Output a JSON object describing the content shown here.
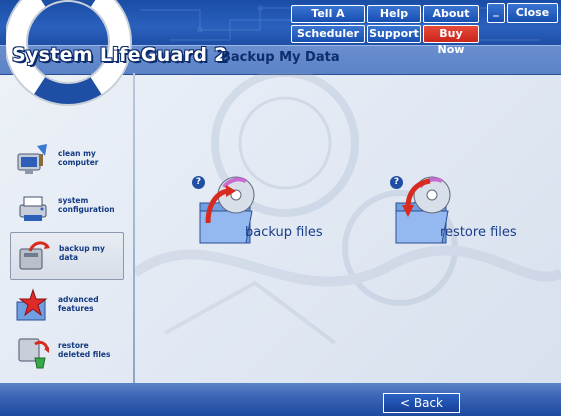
{
  "app": {
    "logo_text": "System LifeGuard 2",
    "page_title": "Backup My Data"
  },
  "header": {
    "tell_friend": "Tell A Friend",
    "help": "Help",
    "about": "About",
    "minimize": "_",
    "close": "Close",
    "scheduler": "Scheduler",
    "support": "Support",
    "buy_now": "Buy Now"
  },
  "sidebar": {
    "items": [
      {
        "label": "clean my\ncomputer",
        "icon": "computer-cleanup-icon"
      },
      {
        "label": "system\nconfiguration",
        "icon": "printer-config-icon"
      },
      {
        "label": "backup my\ndata",
        "icon": "backup-drive-icon",
        "active": true
      },
      {
        "label": "advanced\nfeatures",
        "icon": "star-folder-icon"
      },
      {
        "label": "restore\ndeleted files",
        "icon": "recycle-restore-icon"
      }
    ]
  },
  "main": {
    "actions": [
      {
        "label": "backup files",
        "help": "?",
        "icon": "backup-cd-folder-icon"
      },
      {
        "label": "restore files",
        "help": "?",
        "icon": "restore-cd-folder-icon"
      }
    ]
  },
  "footer": {
    "back_label": "< Back"
  },
  "colors": {
    "header_blue": "#1a4da6",
    "title_band": "#5a82c6",
    "nav_text": "#143a82",
    "buy_now_red": "#d8322a",
    "background": "#e3eaf4"
  }
}
